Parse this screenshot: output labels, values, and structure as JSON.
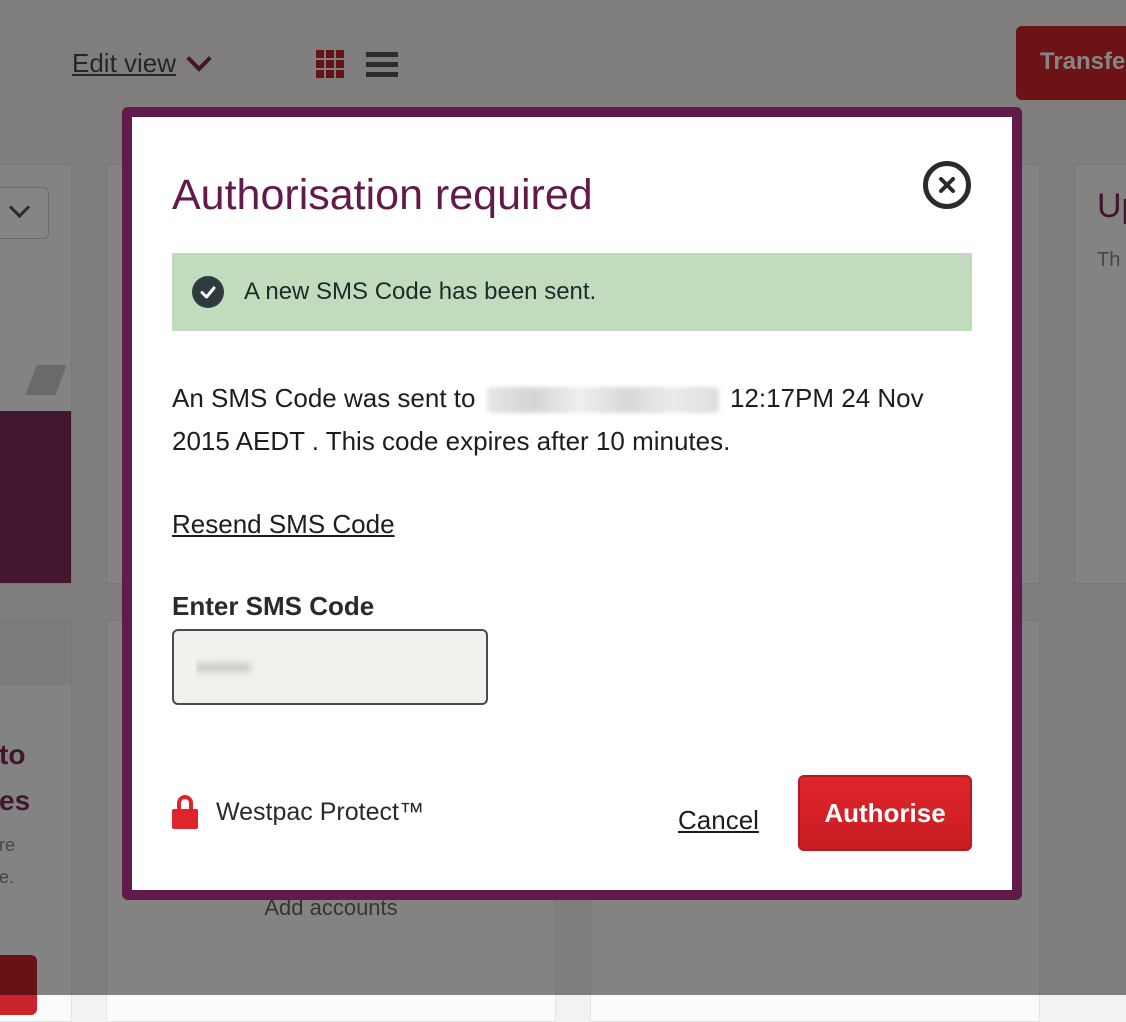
{
  "background": {
    "edit_view_label": "Edit view",
    "transfer_button_label": "Transfer",
    "right_card_title": "Up",
    "right_card_text": "Th",
    "left_card_line1": "to",
    "left_card_line2": "es",
    "left_card_line3": "re",
    "left_card_line4": "e.",
    "add_accounts_label": "Add accounts"
  },
  "modal": {
    "title": "Authorisation required",
    "close_icon": "close-circle-icon",
    "success_message": "A new SMS Code has been sent.",
    "success_icon": "checkmark-circle-icon",
    "info_prefix": "An SMS Code was sent to",
    "info_suffix": "12:17PM 24 Nov 2015 AEDT . This code expires after 10 minutes.",
    "resend_link": "Resend SMS Code",
    "sms_label": "Enter SMS Code",
    "sms_value": "••••••",
    "protect_label": "Westpac Protect™",
    "protect_icon": "lock-icon",
    "cancel_label": "Cancel",
    "authorise_label": "Authorise"
  },
  "colors": {
    "brand_purple": "#621a4b",
    "brand_red": "#d1232a",
    "success_bg": "#c1dcbd"
  }
}
